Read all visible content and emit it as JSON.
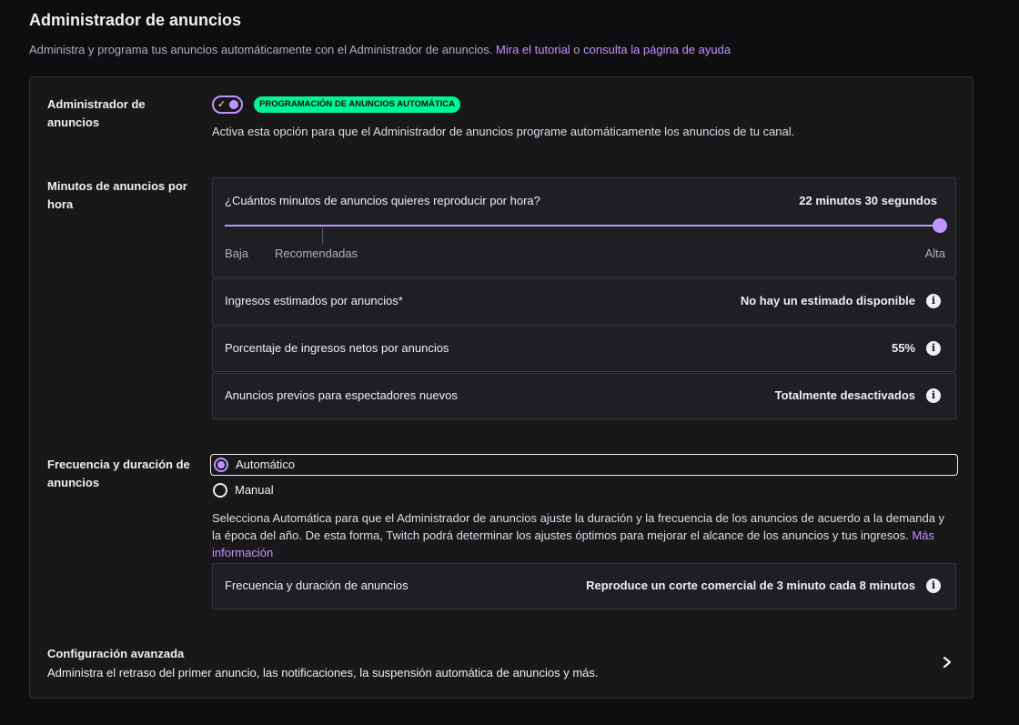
{
  "header": {
    "title": "Administrador de anuncios",
    "subtitle_prefix": "Administra y programa tus anuncios automáticamente con el Administrador de anuncios. ",
    "tutorial_link": "Mira el tutorial",
    "subtitle_mid": " o ",
    "help_link": "consulta la página de ayuda"
  },
  "ad_manager": {
    "label": "Administrador de anuncios",
    "toggle_on": true,
    "badge": "PROGRAMACIÓN DE ANUNCIOS AUTOMÁTICA",
    "description": "Activa esta opción para que el Administrador de anuncios programe automáticamente los anuncios de tu canal."
  },
  "minutes": {
    "label": "Minutos de anuncios por hora",
    "question": "¿Cuántos minutos de anuncios quieres reproducir por hora?",
    "value": "22 minutos 30 segundos",
    "slider_fraction": 1.0,
    "tick_low": "Baja",
    "tick_recommended": "Recomendadas",
    "tick_high": "Alta",
    "rows": [
      {
        "label": "Ingresos estimados por anuncios*",
        "value": "No hay un estimado disponible"
      },
      {
        "label": "Porcentaje de ingresos netos por anuncios",
        "value": "55%"
      },
      {
        "label": "Anuncios previos para espectadores nuevos",
        "value": "Totalmente desactivados"
      }
    ]
  },
  "frequency": {
    "label": "Frecuencia y duración de anuncios",
    "options": [
      {
        "label": "Automático",
        "selected": true
      },
      {
        "label": "Manual",
        "selected": false
      }
    ],
    "description": "Selecciona Automática para que el Administrador de anuncios ajuste la duración y la frecuencia de los anuncios de acuerdo a la demanda y la época del año. De esta forma, Twitch podrá determinar los ajustes óptimos para mejorar el alcance de los anuncios y tus ingresos.",
    "more_link": "Más información",
    "row": {
      "label": "Frecuencia y duración de anuncios",
      "value": "Reproduce un corte comercial de 3 minuto cada 8 minutos"
    }
  },
  "advanced": {
    "title": "Configuración avanzada",
    "description": "Administra el retraso del primer anuncio, las notificaciones, la suspensión automática de anuncios y más."
  },
  "icons": {
    "info": "info-icon",
    "chevron": "chevron-right-icon",
    "check": "check-icon"
  },
  "colors": {
    "accent": "#bf94ff",
    "badge": "#00f593",
    "background": "#0e0e10",
    "card": "#18181b"
  }
}
